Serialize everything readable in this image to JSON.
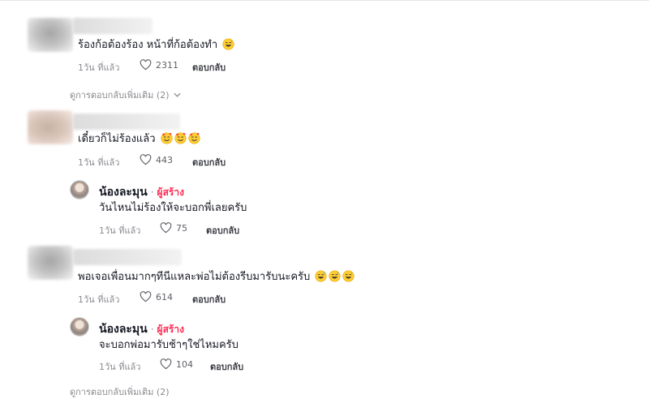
{
  "colors": {
    "accent": "#fe2c55",
    "text": "#161823",
    "muted": "#8a8b91"
  },
  "icons": {
    "like": "heart-outline-icon",
    "expand": "chevron-down-icon",
    "emoji": "grinning-sweat-face-emoji",
    "emoji_love": "smiling-face-with-hearts-emoji"
  },
  "comments": [
    {
      "text": "ร้องก้อต้องร้อง หน้าที่ก้อต้องทำ",
      "time": "1วัน ที่แล้ว",
      "likes": "2311",
      "reply_label": "ตอบกลับ",
      "more_replies": "ดูการตอบกลับเพิ่มเติม (2)"
    },
    {
      "text": "เดี๋ยวก็ไม่ร้องแล้ว",
      "time": "1วัน ที่แล้ว",
      "likes": "443",
      "reply_label": "ตอบกลับ",
      "reply": {
        "author": "น้องละมุน",
        "separator": "·",
        "badge": "ผู้สร้าง",
        "text": "วันไหนไม่ร้องให้จะบอกพี่เลยครับ",
        "time": "1วัน ที่แล้ว",
        "likes": "75",
        "reply_label": "ตอบกลับ"
      }
    },
    {
      "text": "พอเจอเพื่อนมากๆทีนีแหละพ่อไม่ต้องรีบมารับนะครับ",
      "time": "1วัน ที่แล้ว",
      "likes": "614",
      "reply_label": "ตอบกลับ",
      "reply": {
        "author": "น้องละมุน",
        "separator": "·",
        "badge": "ผู้สร้าง",
        "text": "จะบอกพ่อมารับช้าๆใช่ไหมครับ",
        "time": "1วัน ที่แล้ว",
        "likes": "104",
        "reply_label": "ตอบกลับ"
      },
      "more_replies": "ดูการตอบกลับเพิ่มเติม (2)"
    }
  ]
}
